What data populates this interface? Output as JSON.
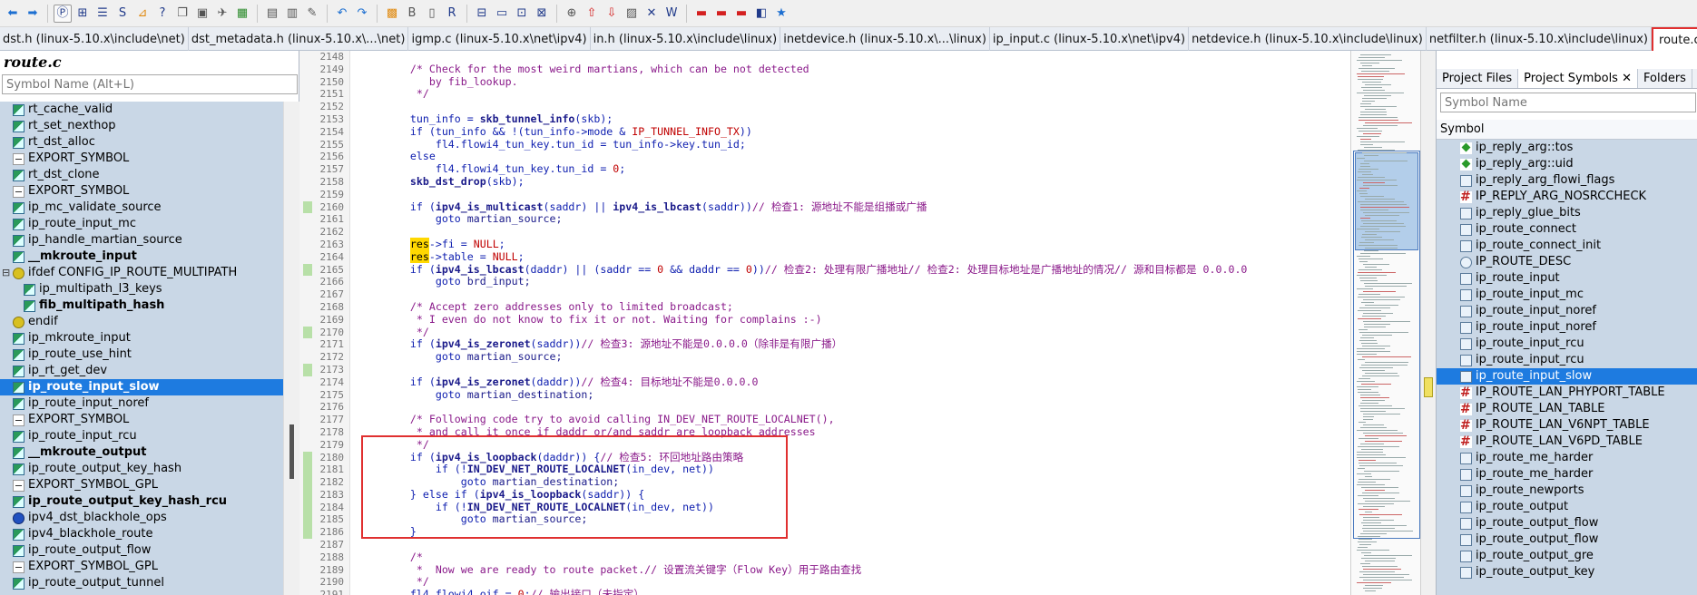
{
  "tabs": [
    {
      "label": "dst.h (linux-5.10.x\\include\\net)",
      "active": false
    },
    {
      "label": "dst_metadata.h (linux-5.10.x\\...\\net)",
      "active": false
    },
    {
      "label": "igmp.c (linux-5.10.x\\net\\ipv4)",
      "active": false
    },
    {
      "label": "in.h (linux-5.10.x\\include\\linux)",
      "active": false
    },
    {
      "label": "inetdevice.h (linux-5.10.x\\...\\linux)",
      "active": false
    },
    {
      "label": "ip_input.c (linux-5.10.x\\net\\ipv4)",
      "active": false
    },
    {
      "label": "netdevice.h (linux-5.10.x\\include\\linux)",
      "active": false
    },
    {
      "label": "netfilter.h (linux-5.10.x\\include\\linux)",
      "active": false
    },
    {
      "label": "route.c (linux-5.10.x\\net\\ipv4)",
      "active": true
    }
  ],
  "left_panel": {
    "title": "route.c",
    "search_placeholder": "Symbol Name (Alt+L)",
    "items": [
      {
        "label": "rt_cache_valid",
        "icon": "func"
      },
      {
        "label": "rt_set_nexthop",
        "icon": "func"
      },
      {
        "label": "rt_dst_alloc",
        "icon": "func"
      },
      {
        "label": "EXPORT_SYMBOL",
        "icon": "macro"
      },
      {
        "label": "rt_dst_clone",
        "icon": "func"
      },
      {
        "label": "EXPORT_SYMBOL",
        "icon": "macro"
      },
      {
        "label": "ip_mc_validate_source",
        "icon": "func"
      },
      {
        "label": "ip_route_input_mc",
        "icon": "func"
      },
      {
        "label": "ip_handle_martian_source",
        "icon": "func"
      },
      {
        "label": "__mkroute_input",
        "icon": "func",
        "bold": true
      },
      {
        "label": "ifdef CONFIG_IP_ROUTE_MULTIPATH",
        "icon": "cond"
      },
      {
        "label": "ip_multipath_l3_keys",
        "icon": "func",
        "indent": 1
      },
      {
        "label": "fib_multipath_hash",
        "icon": "func",
        "indent": 1,
        "bold": true
      },
      {
        "label": "endif",
        "icon": "cond"
      },
      {
        "label": "ip_mkroute_input",
        "icon": "func"
      },
      {
        "label": "ip_route_use_hint",
        "icon": "func"
      },
      {
        "label": "ip_rt_get_dev",
        "icon": "func"
      },
      {
        "label": "ip_route_input_slow",
        "icon": "func",
        "selected": true
      },
      {
        "label": "ip_route_input_noref",
        "icon": "func"
      },
      {
        "label": "EXPORT_SYMBOL",
        "icon": "macro"
      },
      {
        "label": "ip_route_input_rcu",
        "icon": "func"
      },
      {
        "label": "__mkroute_output",
        "icon": "func",
        "bold": true
      },
      {
        "label": "ip_route_output_key_hash",
        "icon": "func"
      },
      {
        "label": "EXPORT_SYMBOL_GPL",
        "icon": "macro"
      },
      {
        "label": "ip_route_output_key_hash_rcu",
        "icon": "func",
        "bold": true
      },
      {
        "label": "ipv4_dst_blackhole_ops",
        "icon": "struct"
      },
      {
        "label": "ipv4_blackhole_route",
        "icon": "func"
      },
      {
        "label": "ip_route_output_flow",
        "icon": "func"
      },
      {
        "label": "EXPORT_SYMBOL_GPL",
        "icon": "macro"
      },
      {
        "label": "ip_route_output_tunnel",
        "icon": "func"
      }
    ]
  },
  "gutter": {
    "line_numbers": [
      "2148",
      "2149",
      "2150",
      "2151",
      "2152",
      "2153",
      "2154",
      "2155",
      "2156",
      "2157",
      "2158",
      "2159",
      "2160",
      "2161",
      "2162",
      "2163",
      "2164",
      "2165",
      "2166",
      "2167",
      "2168",
      "2169",
      "2170",
      "2171",
      "2172",
      "2173",
      "2174",
      "2175",
      "2176",
      "2177",
      "2178",
      "2179",
      "2180",
      "2181",
      "2182",
      "2183",
      "2184",
      "2185",
      "2186",
      "2187",
      "2188",
      "2189",
      "2190",
      "2191"
    ],
    "marked": [
      "2160",
      "2165",
      "2170",
      "2173",
      "2180",
      "2181",
      "2182",
      "2183",
      "2184",
      "2185",
      "2186"
    ]
  },
  "code_lines": [
    [
      {
        "t": "",
        "c": ""
      }
    ],
    [
      {
        "t": "    /* Check for the most weird martians, which can be not detected",
        "c": "cm"
      }
    ],
    [
      {
        "t": "       by fib_lookup.",
        "c": "cm"
      }
    ],
    [
      {
        "t": "     */",
        "c": "cm"
      }
    ],
    [
      {
        "t": "",
        "c": ""
      }
    ],
    [
      {
        "t": "    tun_info = ",
        "c": "kw"
      },
      {
        "t": "skb_tunnel_info",
        "c": "fn"
      },
      {
        "t": "(skb);",
        "c": "kw"
      }
    ],
    [
      {
        "t": "    if (",
        "c": "kw"
      },
      {
        "t": "tun_info && !(tun_info->mode & ",
        "c": "kw"
      },
      {
        "t": "IP_TUNNEL_INFO_TX",
        "c": "mac"
      },
      {
        "t": "))",
        "c": "kw"
      }
    ],
    [
      {
        "t": "        fl4.flowi4_tun_key.tun_id = tun_info->key.tun_id;",
        "c": "kw"
      }
    ],
    [
      {
        "t": "    else",
        "c": "kw"
      }
    ],
    [
      {
        "t": "        fl4.flowi4_tun_key.tun_id = ",
        "c": "kw"
      },
      {
        "t": "0",
        "c": "num"
      },
      {
        "t": ";",
        "c": "kw"
      }
    ],
    [
      {
        "t": "    ",
        "c": ""
      },
      {
        "t": "skb_dst_drop",
        "c": "fn"
      },
      {
        "t": "(skb);",
        "c": "kw"
      }
    ],
    [
      {
        "t": "",
        "c": ""
      }
    ],
    [
      {
        "t": "    if (",
        "c": "kw"
      },
      {
        "t": "ipv4_is_multicast",
        "c": "fn"
      },
      {
        "t": "(saddr) || ",
        "c": "kw"
      },
      {
        "t": "ipv4_is_lbcast",
        "c": "fn"
      },
      {
        "t": "(saddr))",
        "c": "kw"
      },
      {
        "t": "// 检查1: 源地址不能是组播或广播",
        "c": "cm"
      }
    ],
    [
      {
        "t": "        goto ",
        "c": "kw"
      },
      {
        "t": "martian_source;",
        "c": "lbl"
      }
    ],
    [
      {
        "t": "",
        "c": ""
      }
    ],
    [
      {
        "t": "    ",
        "c": ""
      },
      {
        "t": "res",
        "c": "hl"
      },
      {
        "t": "->fi = ",
        "c": "kw"
      },
      {
        "t": "NULL",
        "c": "mac"
      },
      {
        "t": ";",
        "c": "kw"
      }
    ],
    [
      {
        "t": "    ",
        "c": ""
      },
      {
        "t": "res",
        "c": "hl"
      },
      {
        "t": "->table = ",
        "c": "kw"
      },
      {
        "t": "NULL",
        "c": "mac"
      },
      {
        "t": ";",
        "c": "kw"
      }
    ],
    [
      {
        "t": "    if (",
        "c": "kw"
      },
      {
        "t": "ipv4_is_lbcast",
        "c": "fn"
      },
      {
        "t": "(daddr) || (saddr == ",
        "c": "kw"
      },
      {
        "t": "0",
        "c": "num"
      },
      {
        "t": " && daddr == ",
        "c": "kw"
      },
      {
        "t": "0",
        "c": "num"
      },
      {
        "t": "))",
        "c": "kw"
      },
      {
        "t": "// 检查2: 处理有限广播地址// 检查2: 处理目标地址是广播地址的情况// 源和目标都是 0.0.0.0",
        "c": "cm"
      }
    ],
    [
      {
        "t": "        goto ",
        "c": "kw"
      },
      {
        "t": "brd_input;",
        "c": "lbl"
      }
    ],
    [
      {
        "t": "",
        "c": ""
      }
    ],
    [
      {
        "t": "    /* Accept zero addresses only to limited broadcast;",
        "c": "cm"
      }
    ],
    [
      {
        "t": "     * I even do not know to fix it or not. Waiting for complains :-)",
        "c": "cm"
      }
    ],
    [
      {
        "t": "     */",
        "c": "cm"
      }
    ],
    [
      {
        "t": "    if (",
        "c": "kw"
      },
      {
        "t": "ipv4_is_zeronet",
        "c": "fn"
      },
      {
        "t": "(saddr))",
        "c": "kw"
      },
      {
        "t": "// 检查3: 源地址不能是0.0.0.0（除非是有限广播）",
        "c": "cm"
      }
    ],
    [
      {
        "t": "        goto ",
        "c": "kw"
      },
      {
        "t": "martian_source;",
        "c": "lbl"
      }
    ],
    [
      {
        "t": "",
        "c": ""
      }
    ],
    [
      {
        "t": "    if (",
        "c": "kw"
      },
      {
        "t": "ipv4_is_zeronet",
        "c": "fn"
      },
      {
        "t": "(daddr))",
        "c": "kw"
      },
      {
        "t": "// 检查4: 目标地址不能是0.0.0.0",
        "c": "cm"
      }
    ],
    [
      {
        "t": "        goto ",
        "c": "kw"
      },
      {
        "t": "martian_destination;",
        "c": "lbl"
      }
    ],
    [
      {
        "t": "",
        "c": ""
      }
    ],
    [
      {
        "t": "    /* Following code try to avoid calling IN_DEV_NET_ROUTE_LOCALNET(),",
        "c": "cm"
      }
    ],
    [
      {
        "t": "     * and call it once if daddr or/and saddr are loopback addresses",
        "c": "cm"
      }
    ],
    [
      {
        "t": "     */",
        "c": "cm"
      }
    ],
    [
      {
        "t": "    if (",
        "c": "kw"
      },
      {
        "t": "ipv4_is_loopback",
        "c": "fn"
      },
      {
        "t": "(daddr)) {",
        "c": "kw"
      },
      {
        "t": "// 检查5: 环回地址路由策略",
        "c": "cm"
      }
    ],
    [
      {
        "t": "        if (!",
        "c": "kw"
      },
      {
        "t": "IN_DEV_NET_ROUTE_LOCALNET",
        "c": "fn"
      },
      {
        "t": "(in_dev, net))",
        "c": "kw"
      }
    ],
    [
      {
        "t": "            goto ",
        "c": "kw"
      },
      {
        "t": "martian_destination;",
        "c": "lbl"
      }
    ],
    [
      {
        "t": "    } else if (",
        "c": "kw"
      },
      {
        "t": "ipv4_is_loopback",
        "c": "fn"
      },
      {
        "t": "(saddr)) {",
        "c": "kw"
      }
    ],
    [
      {
        "t": "        if (!",
        "c": "kw"
      },
      {
        "t": "IN_DEV_NET_ROUTE_LOCALNET",
        "c": "fn"
      },
      {
        "t": "(in_dev, net))",
        "c": "kw"
      }
    ],
    [
      {
        "t": "            goto ",
        "c": "kw"
      },
      {
        "t": "martian_source;",
        "c": "lbl"
      }
    ],
    [
      {
        "t": "    }",
        "c": "kw"
      }
    ],
    [
      {
        "t": "",
        "c": ""
      }
    ],
    [
      {
        "t": "    /*",
        "c": "cm"
      }
    ],
    [
      {
        "t": "     *  Now we are ready to route packet.// 设置流关键字（Flow Key）用于路由查找",
        "c": "cm"
      }
    ],
    [
      {
        "t": "     */",
        "c": "cm"
      }
    ],
    [
      {
        "t": "    fl4.flowi4_oif = ",
        "c": "kw"
      },
      {
        "t": "0",
        "c": "num"
      },
      {
        "t": ";",
        "c": "kw"
      },
      {
        "t": "// 输出接口（未指定）",
        "c": "cm"
      }
    ]
  ],
  "right_panel": {
    "tabs": [
      {
        "label": "Project Files",
        "active": false
      },
      {
        "label": "Project Symbols ✕",
        "active": true
      },
      {
        "label": "Folders",
        "active": false
      }
    ],
    "search_placeholder": "Symbol Name",
    "header": "Symbol",
    "items": [
      {
        "label": "ip_reply_arg::tos",
        "icon": "var"
      },
      {
        "label": "ip_reply_arg::uid",
        "icon": "var"
      },
      {
        "label": "ip_reply_arg_flowi_flags",
        "icon": "func"
      },
      {
        "label": "IP_REPLY_ARG_NOSRCCHECK",
        "icon": "def"
      },
      {
        "label": "ip_reply_glue_bits",
        "icon": "func"
      },
      {
        "label": "ip_route_connect",
        "icon": "func"
      },
      {
        "label": "ip_route_connect_init",
        "icon": "func"
      },
      {
        "label": "IP_ROUTE_DESC",
        "icon": "struct"
      },
      {
        "label": "ip_route_input",
        "icon": "func"
      },
      {
        "label": "ip_route_input_mc",
        "icon": "func"
      },
      {
        "label": "ip_route_input_noref",
        "icon": "func"
      },
      {
        "label": "ip_route_input_noref",
        "icon": "func"
      },
      {
        "label": "ip_route_input_rcu",
        "icon": "func"
      },
      {
        "label": "ip_route_input_rcu",
        "icon": "func"
      },
      {
        "label": "ip_route_input_slow",
        "icon": "func",
        "selected": true
      },
      {
        "label": "IP_ROUTE_LAN_PHYPORT_TABLE",
        "icon": "def"
      },
      {
        "label": "IP_ROUTE_LAN_TABLE",
        "icon": "def"
      },
      {
        "label": "IP_ROUTE_LAN_V6NPT_TABLE",
        "icon": "def"
      },
      {
        "label": "IP_ROUTE_LAN_V6PD_TABLE",
        "icon": "def"
      },
      {
        "label": "ip_route_me_harder",
        "icon": "func"
      },
      {
        "label": "ip_route_me_harder",
        "icon": "func"
      },
      {
        "label": "ip_route_newports",
        "icon": "func"
      },
      {
        "label": "ip_route_output",
        "icon": "func"
      },
      {
        "label": "ip_route_output_flow",
        "icon": "func"
      },
      {
        "label": "ip_route_output_flow",
        "icon": "func"
      },
      {
        "label": "ip_route_output_gre",
        "icon": "func"
      },
      {
        "label": "ip_route_output_key",
        "icon": "func"
      }
    ]
  },
  "toolbar_icons": [
    "back-arrow",
    "forward-arrow",
    "sep",
    "p-icon",
    "tree-icon",
    "outline-icon",
    "s-icon",
    "graph-icon",
    "help-icon",
    "copy-icon",
    "paste-icon",
    "bird-icon",
    "grid-icon",
    "sep",
    "page-icon",
    "doc-icon",
    "clip-icon",
    "sep",
    "undo-icon",
    "redo-icon",
    "sep",
    "build-icon",
    "b-icon",
    "book-icon",
    "r-icon",
    "sep",
    "layout1-icon",
    "layout2-icon",
    "layout3-icon",
    "layout4-icon",
    "sep",
    "zoom-icon",
    "up-icon",
    "down-icon",
    "image-icon",
    "xy-icon",
    "wiki-icon",
    "sep",
    "bookmark1-icon",
    "bookmark2-icon",
    "bookmark3-icon",
    "bookmark4-icon",
    "star-icon"
  ]
}
